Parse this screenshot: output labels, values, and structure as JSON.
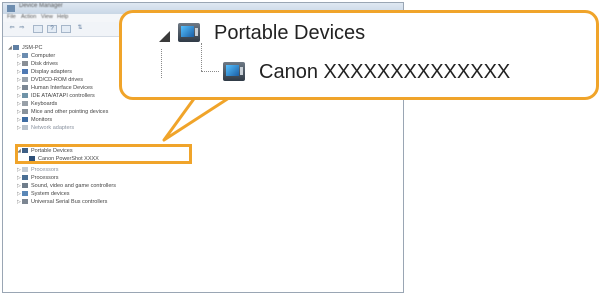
{
  "window": {
    "title": "Device Manager",
    "menu": [
      "File",
      "Action",
      "View",
      "Help"
    ],
    "toolbar": [
      "back",
      "forward",
      "properties",
      "help",
      "scan"
    ]
  },
  "tree": {
    "root": "JSM-PC",
    "items": [
      {
        "label": "Computer",
        "dim": false
      },
      {
        "label": "Disk drives",
        "dim": false
      },
      {
        "label": "Display adapters",
        "dim": false
      },
      {
        "label": "DVD/CD-ROM drives",
        "dim": false
      },
      {
        "label": "Human Interface Devices",
        "dim": false
      },
      {
        "label": "IDE ATA/ATAPI controllers",
        "dim": false
      },
      {
        "label": "Keyboards",
        "dim": false
      },
      {
        "label": "Mice and other pointing devices",
        "dim": false
      },
      {
        "label": "Monitors",
        "dim": false
      },
      {
        "label": "Network adapters",
        "dim": true
      },
      {
        "label": "Portable Devices",
        "dim": false
      },
      {
        "label": "Canon PowerShot XXXX",
        "dim": false
      },
      {
        "label": "Processors",
        "dim": true
      },
      {
        "label": "Processors",
        "dim": false
      },
      {
        "label": "Sound, video and game controllers",
        "dim": false
      },
      {
        "label": "System devices",
        "dim": false
      },
      {
        "label": "Universal Serial Bus controllers",
        "dim": false
      }
    ]
  },
  "callout": {
    "parent_label": "Portable Devices",
    "child_label": "Canon XXXXXXXXXXXXXX"
  },
  "colors": {
    "highlight": "#f0a42a"
  }
}
